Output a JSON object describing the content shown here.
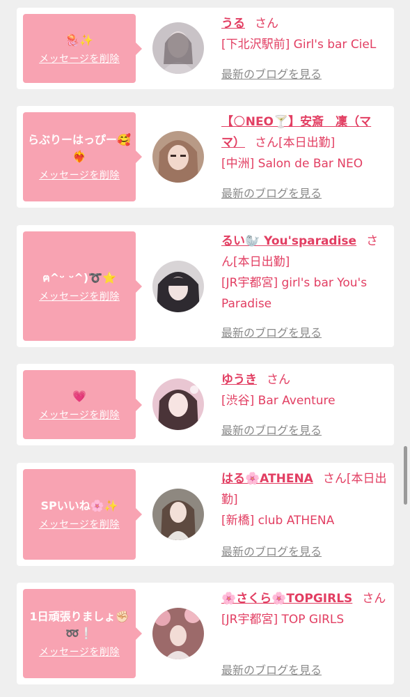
{
  "delete_label": "メッセージを削除",
  "san_label": "さん",
  "blog_label": "最新のブログを見る",
  "colors": {
    "background": "#efefef",
    "card": "#ffffff",
    "bubble": "#f8a3b2",
    "accent": "#e23e62",
    "muted": "#8a8a8a"
  },
  "cards": [
    {
      "message": "🪼✨",
      "name": "うる",
      "status": "",
      "shop": "[下北沢駅前] Girl's bar CieL"
    },
    {
      "message": "らぶりーはっぴー🥰❤️‍🔥",
      "name": "【🌕NEO🍸】安斎　凜（ママ）",
      "status": "[本日出勤]",
      "shop": "[中洲] Salon de Bar NEO"
    },
    {
      "message": "ฅ^ᵕ ᵕ^)➰⭐",
      "name": "るい🦭 You'sparadise",
      "status": "[本日出勤]",
      "shop": "[JR宇都宮] girl's bar You's Paradise"
    },
    {
      "message": "💗",
      "name": "ゆうき",
      "status": "",
      "shop": "[渋谷] Bar Aventure"
    },
    {
      "message": "SPいいね🌸✨",
      "name": "はる🌸ATHENA",
      "status": "[本日出勤]",
      "shop": "[新橋] club ATHENA"
    },
    {
      "message": "1日頑張りましょ✊🏻➿❕",
      "name": "🌸さくら🌸TOPGIRLS",
      "status": "",
      "shop": "[JR宇都宮] TOP GIRLS"
    }
  ]
}
